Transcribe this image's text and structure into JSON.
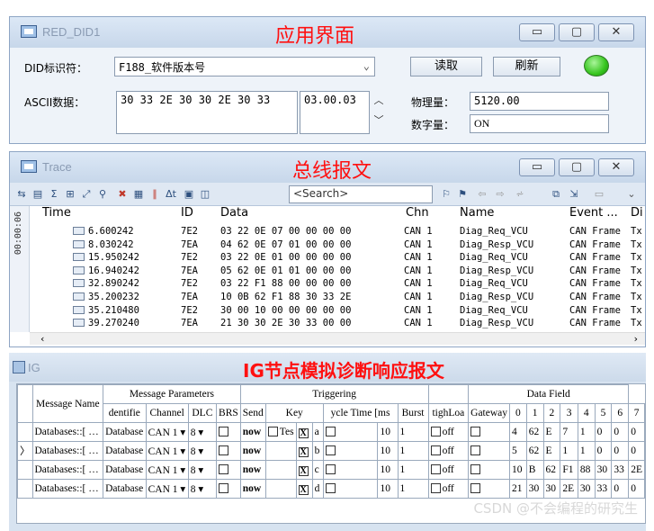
{
  "did_window": {
    "title": "RED_DID1",
    "heading": "应用界面",
    "win_buttons": [
      "▭",
      "▢",
      "✕"
    ],
    "did_label": "DID标识符：",
    "did_value": "F188_软件版本号",
    "read_button": "读取",
    "refresh_button": "刷新",
    "ascii_label": "ASCII数据：",
    "ascii_hex": "30 33 2E 30 30 2E 30 33",
    "ascii_text": "03.00.03",
    "phys_label": "物理量：",
    "phys_value": "5120.00",
    "digital_label": "数字量：",
    "digital_value": "ON",
    "status_color": "#36c51e"
  },
  "trace_window": {
    "title": "Trace",
    "heading": "总线报文",
    "search_placeholder": "<Search>",
    "side_label": "00:00:06",
    "columns": [
      "Time",
      "ID",
      "Data",
      "Chn",
      "Name",
      "Event ...",
      "Di"
    ],
    "rows": [
      {
        "time": "6.600242",
        "id": "7E2",
        "data": "03 22 0E 07 00 00 00 00",
        "chn": "CAN 1",
        "name": "Diag_Req_VCU",
        "event": "CAN Frame",
        "dir": "Tx"
      },
      {
        "time": "8.030242",
        "id": "7EA",
        "data": "04 62 0E 07 01 00 00 00",
        "chn": "CAN 1",
        "name": "Diag_Resp_VCU",
        "event": "CAN Frame",
        "dir": "Tx"
      },
      {
        "time": "15.950242",
        "id": "7E2",
        "data": "03 22 0E 01 00 00 00 00",
        "chn": "CAN 1",
        "name": "Diag_Req_VCU",
        "event": "CAN Frame",
        "dir": "Tx"
      },
      {
        "time": "16.940242",
        "id": "7EA",
        "data": "05 62 0E 01 01 00 00 00",
        "chn": "CAN 1",
        "name": "Diag_Resp_VCU",
        "event": "CAN Frame",
        "dir": "Tx"
      },
      {
        "time": "32.890242",
        "id": "7E2",
        "data": "03 22 F1 88 00 00 00 00",
        "chn": "CAN 1",
        "name": "Diag_Req_VCU",
        "event": "CAN Frame",
        "dir": "Tx"
      },
      {
        "time": "35.200232",
        "id": "7EA",
        "data": "10 0B 62 F1 88 30 33 2E",
        "chn": "CAN 1",
        "name": "Diag_Resp_VCU",
        "event": "CAN Frame",
        "dir": "Tx"
      },
      {
        "time": "35.210480",
        "id": "7E2",
        "data": "30 00 10 00 00 00 00 00",
        "chn": "CAN 1",
        "name": "Diag_Req_VCU",
        "event": "CAN Frame",
        "dir": "Tx"
      },
      {
        "time": "39.270240",
        "id": "7EA",
        "data": "21 30 30 2E 30 33 00 00",
        "chn": "CAN 1",
        "name": "Diag_Resp_VCU",
        "event": "CAN Frame",
        "dir": "Tx"
      }
    ]
  },
  "ig_window": {
    "title": "IG",
    "heading": "IG节点模拟诊断响应报文",
    "group_headers": {
      "params": "Message Parameters",
      "triggering": "Triggering",
      "data_field": "Data Field"
    },
    "columns": {
      "message_name": "Message Name",
      "identifier": "dentifie",
      "channel": "Channel",
      "dlc": "DLC",
      "brs": "BRS",
      "send": "Send",
      "key": "Key",
      "cycle": "ycle Time [ms",
      "burst": "Burst",
      "tighload": "tighLoa",
      "gateway": "Gateway",
      "data_cols": [
        "0",
        "1",
        "2",
        "3",
        "4",
        "5",
        "6",
        "7"
      ]
    },
    "rows": [
      {
        "marker": "",
        "message": "Databases::[",
        "identifier": "Database",
        "channel": "CAN 1",
        "dlc": "8",
        "send": "now",
        "key_extra": "Tes",
        "key_checked": "X",
        "key": "a",
        "cycle": "10",
        "burst": "1",
        "load": "off",
        "data": [
          "4",
          "62",
          "E",
          "7",
          "1",
          "0",
          "0",
          "0"
        ]
      },
      {
        "marker": "〉",
        "message": "Databases::[",
        "identifier": "Database",
        "channel": "CAN 1",
        "dlc": "8",
        "send": "now",
        "key_extra": "",
        "key_checked": "X",
        "key": "b",
        "cycle": "10",
        "burst": "1",
        "load": "off",
        "data": [
          "5",
          "62",
          "E",
          "1",
          "1",
          "0",
          "0",
          "0"
        ]
      },
      {
        "marker": "",
        "message": "Databases::[",
        "identifier": "Database",
        "channel": "CAN 1",
        "dlc": "8",
        "send": "now",
        "key_extra": "",
        "key_checked": "X",
        "key": "c",
        "cycle": "10",
        "burst": "1",
        "load": "off",
        "data": [
          "10",
          "B",
          "62",
          "F1",
          "88",
          "30",
          "33",
          "2E"
        ]
      },
      {
        "marker": "",
        "message": "Databases::[",
        "identifier": "Database",
        "channel": "CAN 1",
        "dlc": "8",
        "send": "now",
        "key_extra": "",
        "key_checked": "X",
        "key": "d",
        "cycle": "10",
        "burst": "1",
        "load": "off",
        "data": [
          "21",
          "30",
          "30",
          "2E",
          "30",
          "33",
          "0",
          "0"
        ]
      }
    ]
  },
  "watermark": "CSDN @不会编程的研究生"
}
